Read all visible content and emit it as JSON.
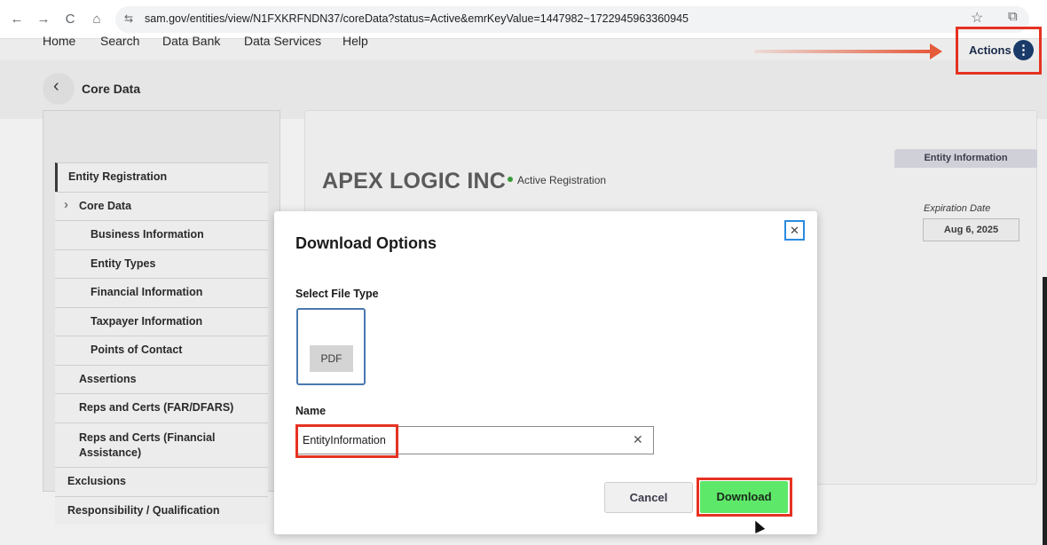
{
  "browser": {
    "url": "sam.gov/entities/view/N1FXKRFNDN37/coreData?status=Active&emrKeyValue=1447982~1722945963360945",
    "back_icon": "←",
    "forward_icon": "→",
    "reload_icon": "C",
    "home_icon": "⌂",
    "tune_icon": "⇆",
    "star_icon": "☆",
    "extensions_icon": "⧉"
  },
  "topnav": [
    "Home",
    "Search",
    "Data Bank",
    "Data Services",
    "Help"
  ],
  "header": {
    "back_icon": "‹",
    "title": "Core Data",
    "actions_label": "Actions",
    "actions_icon": "⋮"
  },
  "sidebar": {
    "items": [
      {
        "label": "Entity Registration",
        "level": 0
      },
      {
        "label": "Core Data",
        "level": 1,
        "chevron": "›"
      },
      {
        "label": "Business Information",
        "level": 2
      },
      {
        "label": "Entity Types",
        "level": 2
      },
      {
        "label": "Financial Information",
        "level": 2
      },
      {
        "label": "Taxpayer Information",
        "level": 2
      },
      {
        "label": "Points of Contact",
        "level": 2
      },
      {
        "label": "Assertions",
        "level": 1
      },
      {
        "label": "Reps and Certs (FAR/DFARS)",
        "level": 1
      },
      {
        "label": "Reps and Certs (Financial Assistance)",
        "level": 1
      },
      {
        "label": "Exclusions",
        "level": 0
      },
      {
        "label": "Responsibility / Qualification",
        "level": 0
      }
    ]
  },
  "entity": {
    "name": "APEX LOGIC INC",
    "status": "Active Registration",
    "tab_label": "Entity Information",
    "expiration_label": "Expiration Date",
    "expiration_value": "Aug 6, 2025"
  },
  "modal": {
    "title": "Download Options",
    "close_icon": "✕",
    "file_type_label": "Select File Type",
    "file_type_option": "PDF",
    "name_label": "Name",
    "name_value": "EntityInformation",
    "clear_icon": "✕",
    "cancel_label": "Cancel",
    "download_label": "Download"
  },
  "colors": {
    "highlight": "#e63222",
    "download_button": "#5ee86a",
    "actions_icon_bg": "#1a3a6a",
    "close_focus": "#2a8ae0"
  }
}
